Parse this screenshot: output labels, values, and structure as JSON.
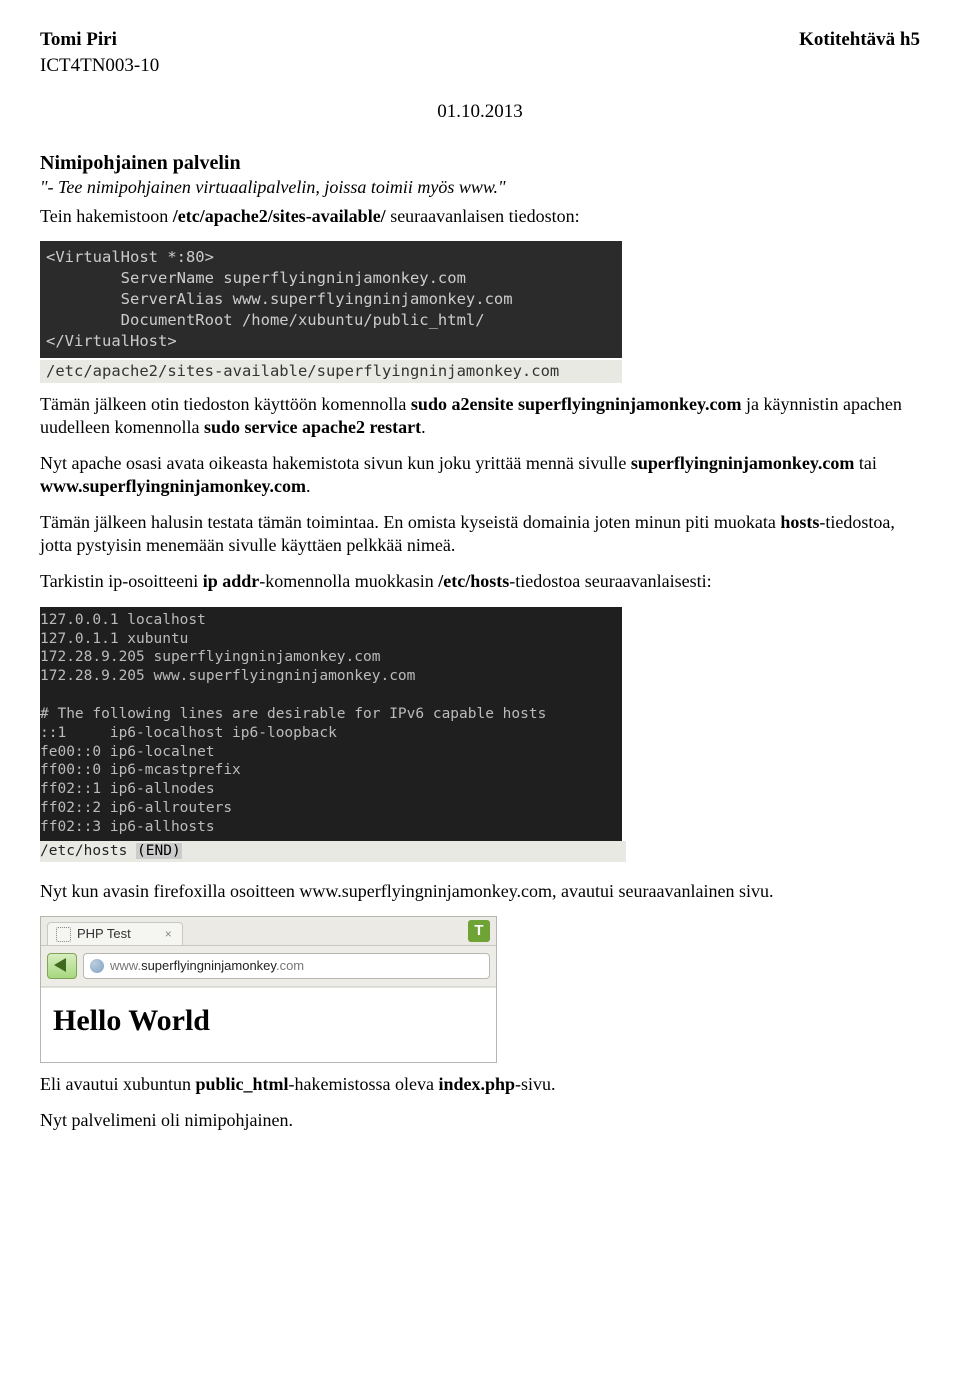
{
  "header": {
    "author": "Tomi Piri",
    "title": "Kotitehtävä h5",
    "course": "ICT4TN003-10",
    "date": "01.10.2013"
  },
  "section": {
    "heading": "Nimipohjainen palvelin",
    "quote": "\"- Tee nimipohjainen virtuaalipalvelin, joissa toimii myös www.\"",
    "p1a": "Tein hakemistoon ",
    "p1b": "/etc/apache2/sites-available/",
    "p1c": " seuraavanlaisen tiedoston:"
  },
  "vhost": {
    "code": "<VirtualHost *:80>\n        ServerName superflyingninjamonkey.com\n        ServerAlias www.superflyingninjamonkey.com\n        DocumentRoot /home/xubuntu/public_html/\n</VirtualHost>",
    "caption": "/etc/apache2/sites-available/superflyingninjamonkey.com"
  },
  "p2": {
    "a": "Tämän jälkeen otin tiedoston käyttöön komennolla ",
    "b": "sudo a2ensite superflyingninjamonkey.com",
    "c": " ja käynnistin apachen uudelleen komennolla ",
    "d": "sudo service apache2 restart",
    "e": "."
  },
  "p3": {
    "a": "Nyt apache osasi avata oikeasta hakemistota sivun kun joku yrittää mennä sivulle ",
    "b": "superflyingninjamonkey.com",
    "c": " tai ",
    "d": "www.superflyingninjamonkey.com",
    "e": "."
  },
  "p4": {
    "a": "Tämän jälkeen halusin testata tämän toimintaa. En omista kyseistä domainia joten minun piti muokata ",
    "b": "hosts",
    "c": "-tiedostoa, jotta pystyisin menemään sivulle käyttäen pelkkää nimeä."
  },
  "p5": {
    "a": "Tarkistin ip-osoitteeni ",
    "b": "ip addr",
    "c": "-komennolla muokkasin ",
    "d": "/etc/hosts",
    "e": "-tiedostoa seuraavanlaisesti:"
  },
  "hosts": {
    "code": "127.0.0.1 localhost\n127.0.1.1 xubuntu\n172.28.9.205 superflyingninjamonkey.com\n172.28.9.205 www.superflyingninjamonkey.com\n\n# The following lines are desirable for IPv6 capable hosts\n::1     ip6-localhost ip6-loopback\nfe00::0 ip6-localnet\nff00::0 ip6-mcastprefix\nff02::1 ip6-allnodes\nff02::2 ip6-allrouters\nff02::3 ip6-allhosts",
    "caption_a": "/etc/hosts ",
    "caption_b": "(END)"
  },
  "p6": "Nyt kun avasin firefoxilla osoitteen www.superflyingninjamonkey.com, avautui seuraavanlainen sivu.",
  "browser": {
    "tab_title": "PHP Test",
    "badge": "T",
    "url_prefix": "www.",
    "url_host": "superflyingninjamonkey",
    "url_suffix": ".com",
    "page_heading": "Hello World"
  },
  "p7": {
    "a": "Eli avautui xubuntun ",
    "b": "public_html",
    "c": "-hakemistossa oleva ",
    "d": "index.php",
    "e": "-sivu."
  },
  "p8": "Nyt palvelimeni oli nimipohjainen."
}
